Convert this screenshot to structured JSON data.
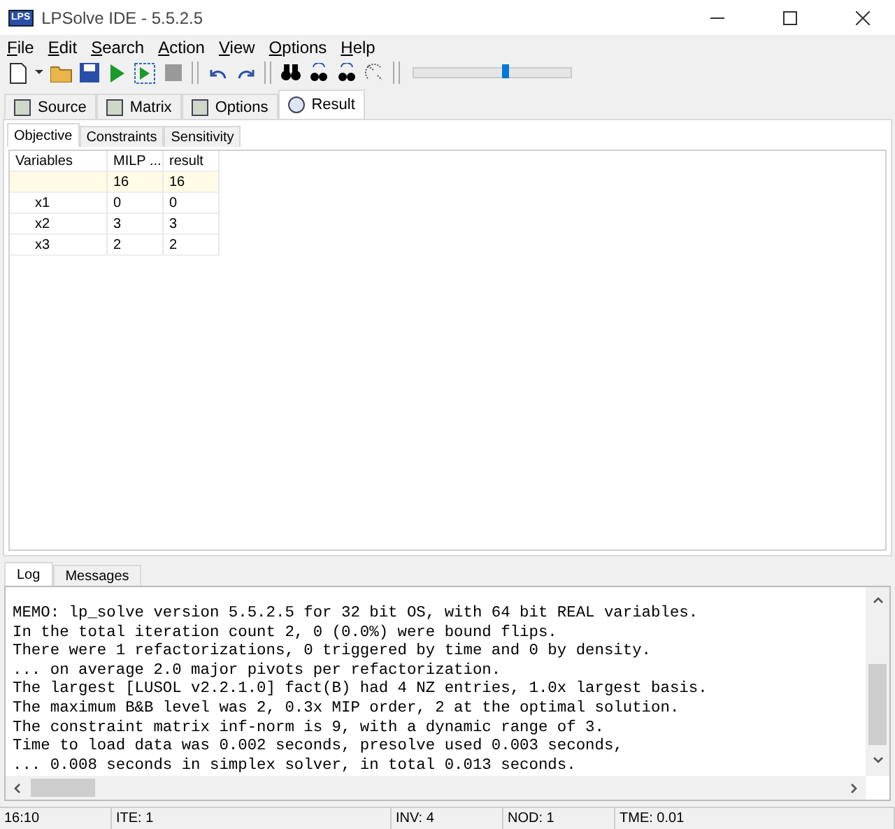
{
  "window": {
    "title": "LPSolve IDE - 5.5.2.5",
    "logo": "LPS"
  },
  "menu": [
    "File",
    "Edit",
    "Search",
    "Action",
    "View",
    "Options",
    "Help"
  ],
  "toolbar": {
    "slider": {
      "level": 0.59
    }
  },
  "tabs": [
    {
      "label": "Source",
      "selected": false
    },
    {
      "label": "Matrix",
      "selected": false
    },
    {
      "label": "Options",
      "selected": false
    },
    {
      "label": "Result",
      "selected": true
    }
  ],
  "subtabs": [
    {
      "label": "Objective",
      "selected": true
    },
    {
      "label": "Constraints",
      "selected": false
    },
    {
      "label": "Sensitivity",
      "selected": false
    }
  ],
  "table": {
    "columns": [
      "Variables",
      "MILP ...",
      "result"
    ],
    "rows": [
      {
        "cells": [
          "",
          "16",
          "16"
        ],
        "highlighted": true
      },
      {
        "cells": [
          "x1",
          "0",
          "0"
        ],
        "highlighted": false
      },
      {
        "cells": [
          "x2",
          "3",
          "3"
        ],
        "highlighted": false
      },
      {
        "cells": [
          "x3",
          "2",
          "2"
        ],
        "highlighted": false
      }
    ]
  },
  "bottom_tabs": [
    {
      "label": "Log",
      "selected": true
    },
    {
      "label": "Messages",
      "selected": false
    }
  ],
  "log": [
    "MEMO: lp_solve version 5.5.2.5 for 32 bit OS, with 64 bit REAL variables.",
    "In the total iteration count 2, 0 (0.0%) were bound flips.",
    "There were 1 refactorizations, 0 triggered by time and 0 by density.",
    "... on average 2.0 major pivots per refactorization.",
    "The largest [LUSOL v2.2.1.0] fact(B) had 4 NZ entries, 1.0x largest basis.",
    "The maximum B&B level was 2, 0.3x MIP order, 2 at the optimal solution.",
    "The constraint matrix inf-norm is 9, with a dynamic range of 3.",
    "Time to load data was 0.002 seconds, presolve used 0.003 seconds,",
    "... 0.008 seconds in simplex solver, in total 0.013 seconds."
  ],
  "status_bar": [
    "16:10",
    "ITE: 1",
    "INV: 4",
    "NOD: 1",
    "TME: 0.01"
  ]
}
